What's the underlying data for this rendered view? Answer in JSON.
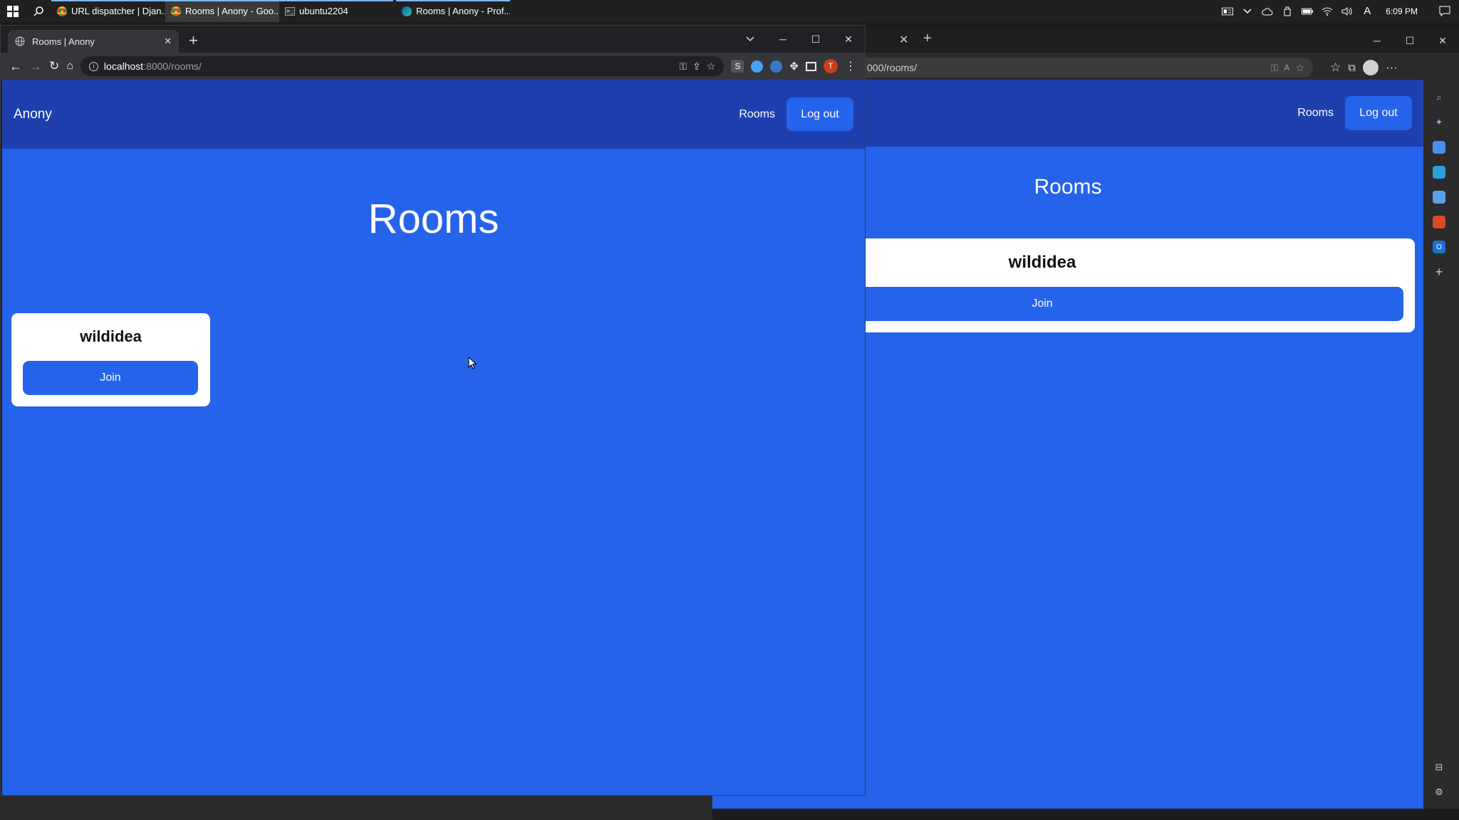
{
  "taskbar": {
    "tasks": [
      {
        "label": "URL dispatcher | Djan...",
        "icon": "chrome-icon"
      },
      {
        "label": "Rooms | Anony - Goo...",
        "icon": "chrome-icon"
      },
      {
        "label": "ubuntu2204",
        "icon": "terminal-icon"
      },
      {
        "label": "Rooms | Anony - Prof...",
        "icon": "edge-icon"
      }
    ],
    "time": "6:09 PM"
  },
  "chrome": {
    "tab_title": "Rooms | Anony",
    "url_host": "localhost",
    "url_path": ":8000/rooms/",
    "profile_initial": "T",
    "ext_s_label": "S"
  },
  "edge": {
    "url_partial": "000/rooms/"
  },
  "site": {
    "brand": "Anony",
    "nav_rooms": "Rooms",
    "logout": "Log out",
    "heading": "Rooms",
    "rooms": [
      {
        "name": "wildidea",
        "join": "Join"
      }
    ]
  },
  "colors": {
    "nav_bg": "#1e40af",
    "page_bg": "#2563eb",
    "button": "#2563eb",
    "card": "#ffffff"
  }
}
